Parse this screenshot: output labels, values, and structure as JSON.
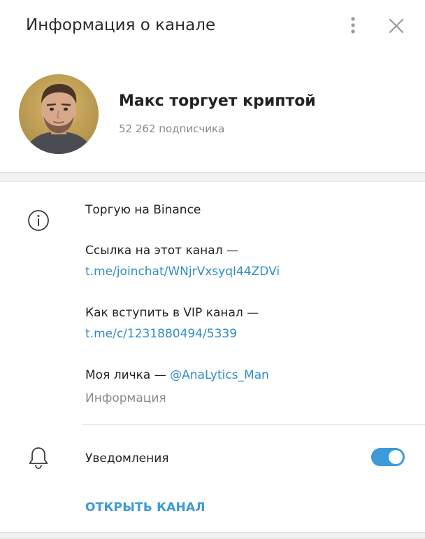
{
  "header": {
    "title": "Информация о канале",
    "menu_icon": "more-vertical-icon",
    "close_icon": "close-icon"
  },
  "profile": {
    "name": "Макс торгует криптой",
    "subscribers": "52 262 подписчика",
    "avatar_icon": "avatar-photo"
  },
  "info": {
    "icon": "info-icon",
    "line1": "Торгую на Binance",
    "line2": "Ссылка на этот канал —",
    "link1": "t.me/joinchat/WNjrVxsyqI44ZDVi",
    "line3": "Как вступить в VIP канал —",
    "link2": "t.me/c/1231880494/5339",
    "line4_prefix": "Моя личка — ",
    "line4_link": "@AnaLytics_Man",
    "caption": "Информация"
  },
  "notifications": {
    "icon": "bell-icon",
    "label": "Уведомления",
    "enabled": true
  },
  "actions": {
    "open_channel": "ОТКРЫТЬ КАНАЛ"
  },
  "colors": {
    "accent": "#3d9ad8",
    "link": "#2f8cc9",
    "muted": "#8a8a8a",
    "divider": "#f1f1f1"
  }
}
